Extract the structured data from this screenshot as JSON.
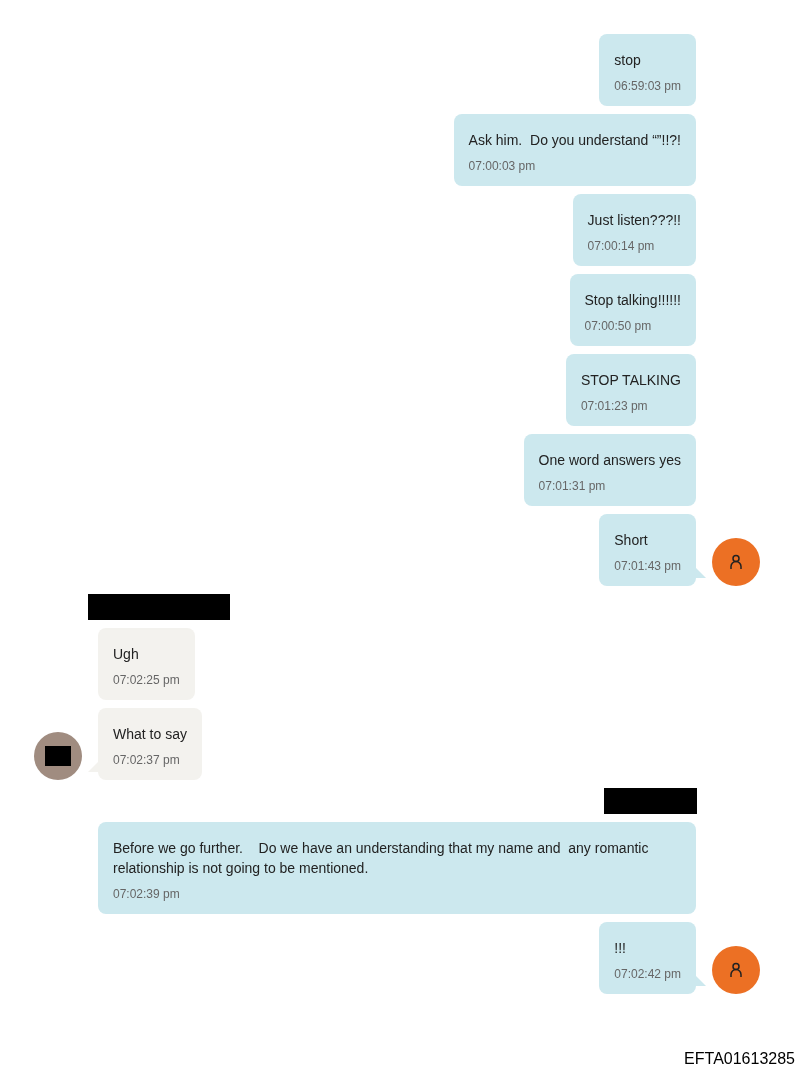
{
  "groups": [
    {
      "kind": "outgoing",
      "name_redacted": false,
      "messages": [
        {
          "text": "stop",
          "time": "06:59:03 pm",
          "avatar": false
        },
        {
          "text": "Ask him.  Do you understand “”!!?!",
          "time": "07:00:03 pm",
          "avatar": false
        },
        {
          "text": "Just listen???!!",
          "time": "07:00:14 pm",
          "avatar": false
        },
        {
          "text": "Stop talking!!!!!!",
          "time": "07:00:50 pm",
          "avatar": false
        },
        {
          "text": "STOP TALKING",
          "time": "07:01:23 pm",
          "avatar": false
        },
        {
          "text": "One word answers yes",
          "time": "07:01:31 pm",
          "avatar": false
        },
        {
          "text": "Short",
          "time": "07:01:43 pm",
          "avatar": true
        }
      ]
    },
    {
      "kind": "incoming",
      "name_redacted": true,
      "messages": [
        {
          "text": "Ugh",
          "time": "07:02:25 pm",
          "avatar": false
        },
        {
          "text": "What to say",
          "time": "07:02:37 pm",
          "avatar": true
        }
      ]
    },
    {
      "kind": "outgoing",
      "name_redacted": true,
      "messages": [
        {
          "text": "Before we go further.    Do we have an understanding that my name and  any romantic relationship is not going to be mentioned.",
          "time": "07:02:39 pm",
          "avatar": false
        },
        {
          "text": "!!!",
          "time": "07:02:42 pm",
          "avatar": true
        }
      ]
    }
  ],
  "document_id": "EFTA01613285"
}
